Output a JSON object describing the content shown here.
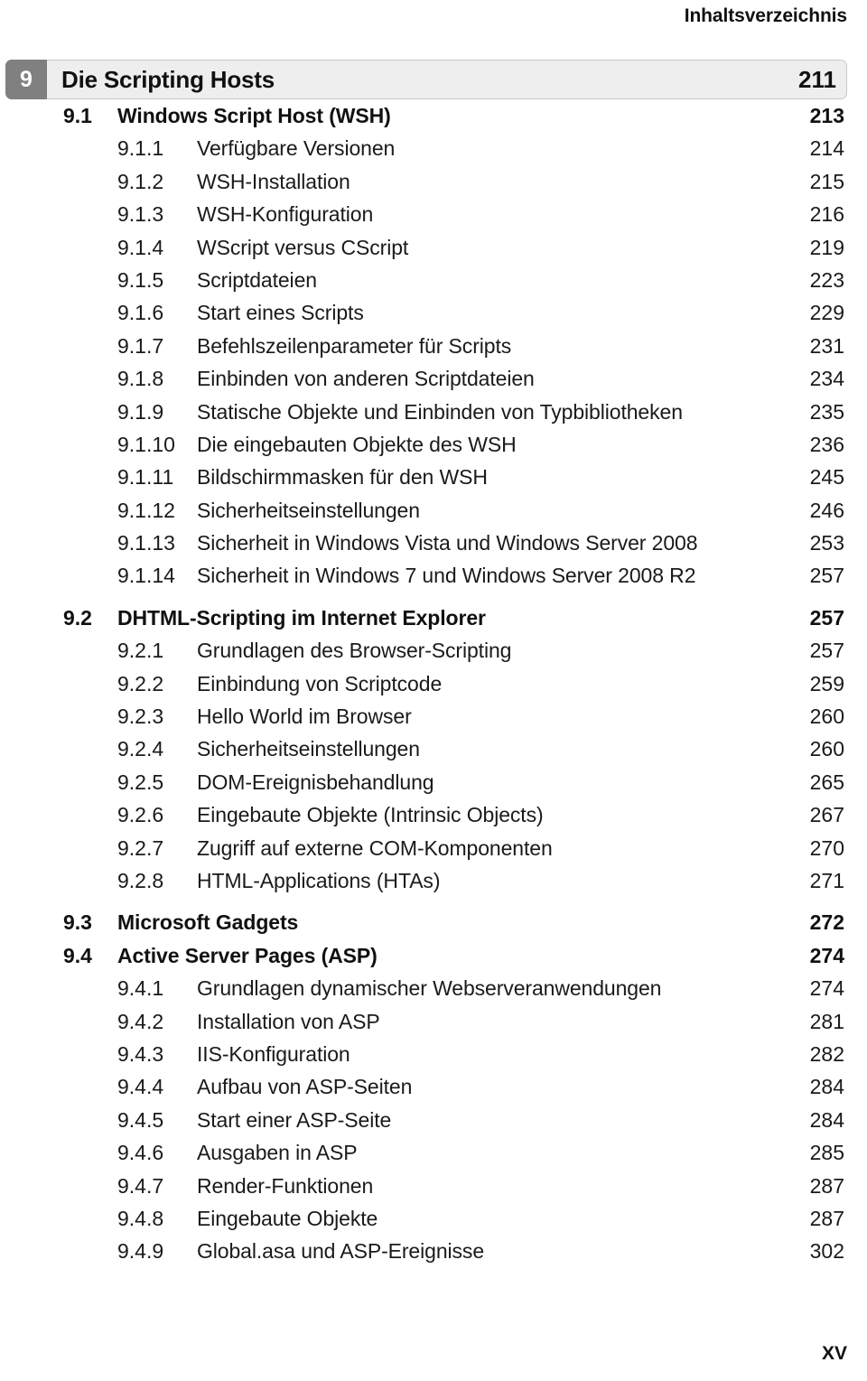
{
  "running_head": "Inhaltsverzeichnis",
  "folio": "XV",
  "chapter": {
    "number": "9",
    "title": "Die Scripting Hosts",
    "page": "211"
  },
  "entries": [
    {
      "level": 2,
      "number": "9.1",
      "title": "Windows Script Host (WSH)",
      "page": "213",
      "gap": false
    },
    {
      "level": 3,
      "number": "9.1.1",
      "title": "Verfügbare Versionen",
      "page": "214",
      "gap": false
    },
    {
      "level": 3,
      "number": "9.1.2",
      "title": "WSH-Installation",
      "page": "215",
      "gap": false
    },
    {
      "level": 3,
      "number": "9.1.3",
      "title": "WSH-Konfiguration",
      "page": "216",
      "gap": false
    },
    {
      "level": 3,
      "number": "9.1.4",
      "title": "WScript versus CScript",
      "page": "219",
      "gap": false
    },
    {
      "level": 3,
      "number": "9.1.5",
      "title": "Scriptdateien",
      "page": "223",
      "gap": false
    },
    {
      "level": 3,
      "number": "9.1.6",
      "title": "Start eines Scripts",
      "page": "229",
      "gap": false
    },
    {
      "level": 3,
      "number": "9.1.7",
      "title": "Befehlszeilenparameter für Scripts",
      "page": "231",
      "gap": false
    },
    {
      "level": 3,
      "number": "9.1.8",
      "title": "Einbinden von anderen Scriptdateien",
      "page": "234",
      "gap": false
    },
    {
      "level": 3,
      "number": "9.1.9",
      "title": "Statische Objekte und Einbinden von Typbibliotheken",
      "page": "235",
      "gap": false
    },
    {
      "level": 3,
      "number": "9.1.10",
      "title": "Die eingebauten Objekte des WSH",
      "page": "236",
      "gap": false,
      "wide": true
    },
    {
      "level": 3,
      "number": "9.1.11",
      "title": "Bildschirmmasken für den WSH",
      "page": "245",
      "gap": false,
      "wide": true
    },
    {
      "level": 3,
      "number": "9.1.12",
      "title": "Sicherheitseinstellungen",
      "page": "246",
      "gap": false,
      "wide": true
    },
    {
      "level": 3,
      "number": "9.1.13",
      "title": "Sicherheit in Windows Vista und Windows Server 2008",
      "page": "253",
      "gap": false,
      "wide": true
    },
    {
      "level": 3,
      "number": "9.1.14",
      "title": "Sicherheit in Windows 7 und Windows Server 2008 R2",
      "page": "257",
      "gap": false,
      "wide": true
    },
    {
      "level": 2,
      "number": "9.2",
      "title": "DHTML-Scripting im Internet Explorer",
      "page": "257",
      "gap": true
    },
    {
      "level": 3,
      "number": "9.2.1",
      "title": "Grundlagen des Browser-Scripting",
      "page": "257",
      "gap": false
    },
    {
      "level": 3,
      "number": "9.2.2",
      "title": "Einbindung von Scriptcode",
      "page": "259",
      "gap": false
    },
    {
      "level": 3,
      "number": "9.2.3",
      "title": "Hello World im Browser",
      "page": "260",
      "gap": false
    },
    {
      "level": 3,
      "number": "9.2.4",
      "title": "Sicherheitseinstellungen",
      "page": "260",
      "gap": false
    },
    {
      "level": 3,
      "number": "9.2.5",
      "title": "DOM-Ereignisbehandlung",
      "page": "265",
      "gap": false
    },
    {
      "level": 3,
      "number": "9.2.6",
      "title": "Eingebaute Objekte (Intrinsic Objects)",
      "page": "267",
      "gap": false
    },
    {
      "level": 3,
      "number": "9.2.7",
      "title": "Zugriff auf externe COM-Komponenten",
      "page": "270",
      "gap": false
    },
    {
      "level": 3,
      "number": "9.2.8",
      "title": "HTML-Applications (HTAs)",
      "page": "271",
      "gap": false
    },
    {
      "level": 2,
      "number": "9.3",
      "title": "Microsoft Gadgets",
      "page": "272",
      "gap": true
    },
    {
      "level": 2,
      "number": "9.4",
      "title": "Active Server Pages (ASP)",
      "page": "274",
      "gap": false
    },
    {
      "level": 3,
      "number": "9.4.1",
      "title": "Grundlagen dynamischer Webserveranwendungen",
      "page": "274",
      "gap": false
    },
    {
      "level": 3,
      "number": "9.4.2",
      "title": "Installation von ASP",
      "page": "281",
      "gap": false
    },
    {
      "level": 3,
      "number": "9.4.3",
      "title": "IIS-Konfiguration",
      "page": "282",
      "gap": false
    },
    {
      "level": 3,
      "number": "9.4.4",
      "title": "Aufbau von ASP-Seiten",
      "page": "284",
      "gap": false
    },
    {
      "level": 3,
      "number": "9.4.5",
      "title": "Start einer ASP-Seite",
      "page": "284",
      "gap": false
    },
    {
      "level": 3,
      "number": "9.4.6",
      "title": "Ausgaben in ASP",
      "page": "285",
      "gap": false
    },
    {
      "level": 3,
      "number": "9.4.7",
      "title": "Render-Funktionen",
      "page": "287",
      "gap": false
    },
    {
      "level": 3,
      "number": "9.4.8",
      "title": "Eingebaute Objekte",
      "page": "287",
      "gap": false
    },
    {
      "level": 3,
      "number": "9.4.9",
      "title": "Global.asa und ASP-Ereignisse",
      "page": "302",
      "gap": false
    }
  ]
}
